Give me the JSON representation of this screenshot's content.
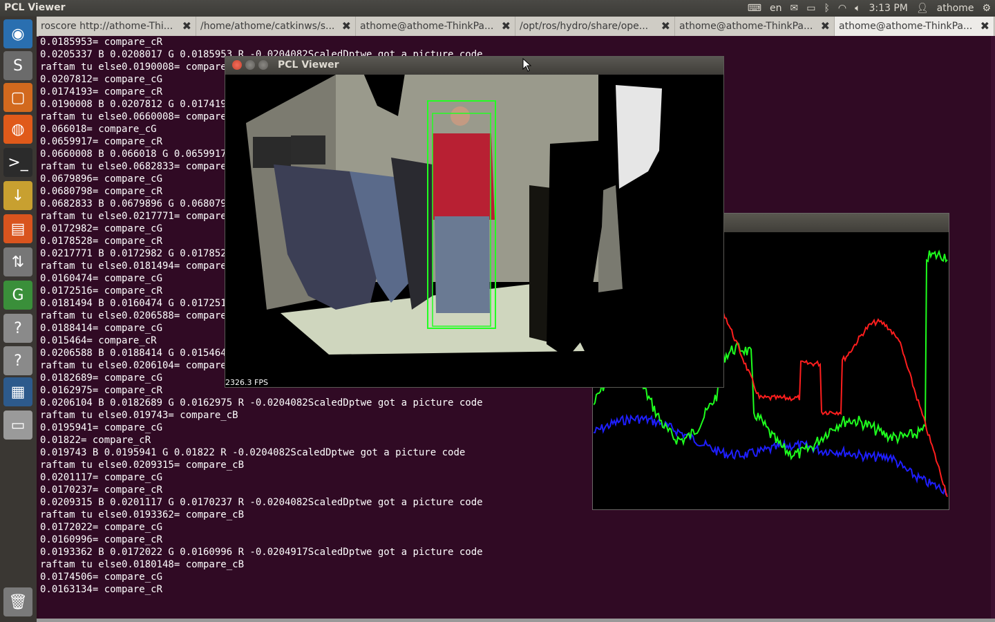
{
  "topbar": {
    "title": "PCL Viewer",
    "lang": "en",
    "time": "3:13 PM",
    "user": "athome"
  },
  "tabs": [
    {
      "label": "roscore http://athome-Thi..."
    },
    {
      "label": "/home/athome/catkinws/s..."
    },
    {
      "label": "athome@athome-ThinkPa..."
    },
    {
      "label": "/opt/ros/hydro/share/ope..."
    },
    {
      "label": "athome@athome-ThinkPa..."
    },
    {
      "label": "athome@athome-ThinkPa..."
    }
  ],
  "terminal_lines": [
    "0.0185953= compare_cR",
    "0.0205337 B 0.0208017 G 0.0185953 R -0.0204082ScaledDptwe got a picture code",
    "raftam tu else0.0190008= compare_cB",
    "0.0207812= compare_cG",
    "0.0174193= compare_cR",
    "0.0190008 B 0.0207812 G 0.0174193 R -0.0204082ScaledDptwe got a picture code",
    "raftam tu else0.0660008= compare_cB",
    "0.066018= compare_cG",
    "0.0659917= compare_cR",
    "0.0660008 B 0.066018 G 0.0659917 R -0.0204082ScaledDptwe got a picture code",
    "raftam tu else0.0682833= compare_cB",
    "0.0679896= compare_cG",
    "0.0680798= compare_cR",
    "0.0682833 B 0.0679896 G 0.0680798 R -0.0204082ScaledDptwe got a picture code",
    "raftam tu else0.0217771= compare_cB",
    "0.0172982= compare_cG",
    "0.0178528= compare_cR",
    "0.0217771 B 0.0172982 G 0.0178528 R -0.0204082ScaledDptwe got a picture code",
    "raftam tu else0.0181494= compare_cB",
    "0.0160474= compare_cG",
    "0.0172516= compare_cR",
    "0.0181494 B 0.0160474 G 0.0172516 R -0.0204082ScaledDptwe got a picture code",
    "raftam tu else0.0206588= compare_cB",
    "0.0188414= compare_cG",
    "0.015464= compare_cR",
    "0.0206588 B 0.0188414 G 0.015464 R -0.0204082ScaledDptwe got a picture code",
    "raftam tu else0.0206104= compare_cB",
    "0.0182689= compare_cG",
    "0.0162975= compare_cR",
    "0.0206104 B 0.0182689 G 0.0162975 R -0.0204082ScaledDptwe got a picture code",
    "raftam tu else0.019743= compare_cB",
    "0.0195941= compare_cG",
    "0.01822= compare_cR",
    "0.019743 B 0.0195941 G 0.01822 R -0.0204082ScaledDptwe got a picture code",
    "raftam tu else0.0209315= compare_cB",
    "0.0201117= compare_cG",
    "0.0170237= compare_cR",
    "0.0209315 B 0.0201117 G 0.0170237 R -0.0204082ScaledDptwe got a picture code",
    "raftam tu else0.0193362= compare_cB",
    "0.0172022= compare_cG",
    "0.0160996= compare_cR",
    "0.0193362 B 0.0172022 G 0.0160996 R -0.0204917ScaledDptwe got a picture code",
    "raftam tu else0.0180148= compare_cB",
    "0.0174506= compare_cG",
    "0.0163134= compare_cR"
  ],
  "pcl_window": {
    "title": "PCL Viewer",
    "fps": "2326.3 FPS"
  },
  "launcher": [
    {
      "icon": "dash-home-icon",
      "color": "#2a6fb0"
    },
    {
      "icon": "sublime-text-icon",
      "color": "#6b6b6b"
    },
    {
      "icon": "files-icon",
      "color": "#d2691e"
    },
    {
      "icon": "firefox-icon",
      "color": "#e05a1a"
    },
    {
      "icon": "terminal-icon",
      "color": "#2b2b2b"
    },
    {
      "icon": "archive-manager-icon",
      "color": "#c8a030"
    },
    {
      "icon": "software-center-icon",
      "color": "#d9541e"
    },
    {
      "icon": "update-manager-icon",
      "color": "#777777"
    },
    {
      "icon": "gedit-icon",
      "color": "#3a8f3a"
    },
    {
      "icon": "unknown-app-icon",
      "color": "#8a8a8a"
    },
    {
      "icon": "unknown-app-icon",
      "color": "#8a8a8a"
    },
    {
      "icon": "workspace-switcher-icon",
      "color": "#2d5a8c"
    },
    {
      "icon": "drive-icon",
      "color": "#9a9a9a"
    },
    {
      "icon": "trash-icon",
      "color": "#7a7a7a"
    }
  ],
  "colors": {
    "terminal_bg": "#300a24",
    "hist_red": "#ff1e1e",
    "hist_green": "#1eff1e",
    "hist_blue": "#1e1eff",
    "bbox": "#22ff22"
  }
}
